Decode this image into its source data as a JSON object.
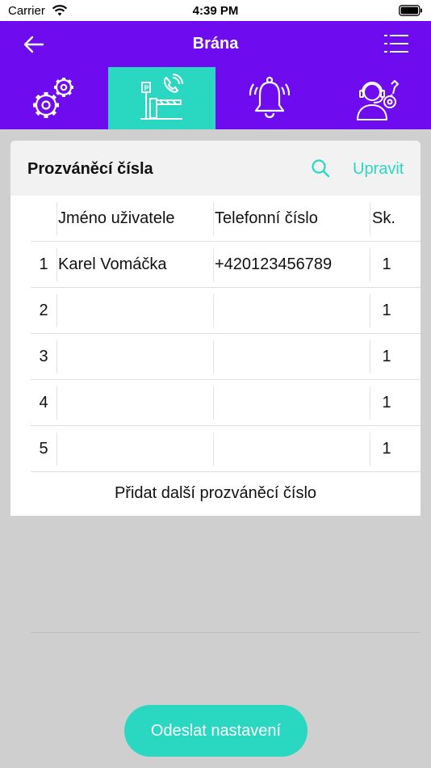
{
  "status_bar": {
    "carrier": "Carrier",
    "time": "4:39 PM"
  },
  "nav": {
    "title": "Brána",
    "back_icon": "arrow-left-icon",
    "menu_icon": "list-icon"
  },
  "tabs": [
    {
      "icon": "gears-icon",
      "active": false
    },
    {
      "icon": "parking-gate-phone-icon",
      "active": true
    },
    {
      "icon": "alarm-bell-icon",
      "active": false
    },
    {
      "icon": "support-technician-icon",
      "active": false
    }
  ],
  "card": {
    "title": "Prozváněcí čísla",
    "edit_label": "Upravit",
    "columns": {
      "num": "",
      "name": "Jméno uživatele",
      "phone": "Telefonní číslo",
      "group": "Sk."
    },
    "rows": [
      {
        "num": "1",
        "name": "Karel Vomáčka",
        "phone": "+420123456789",
        "group": "1"
      },
      {
        "num": "2",
        "name": "",
        "phone": "",
        "group": "1"
      },
      {
        "num": "3",
        "name": "",
        "phone": "",
        "group": "1"
      },
      {
        "num": "4",
        "name": "",
        "phone": "",
        "group": "1"
      },
      {
        "num": "5",
        "name": "",
        "phone": "",
        "group": "1"
      }
    ],
    "add_label": "Přidat další prozváněcí číslo"
  },
  "submit_label": "Odeslat nastavení",
  "colors": {
    "primary": "#6f0bef",
    "accent": "#2ad8c2",
    "background": "#cfcfcf"
  }
}
